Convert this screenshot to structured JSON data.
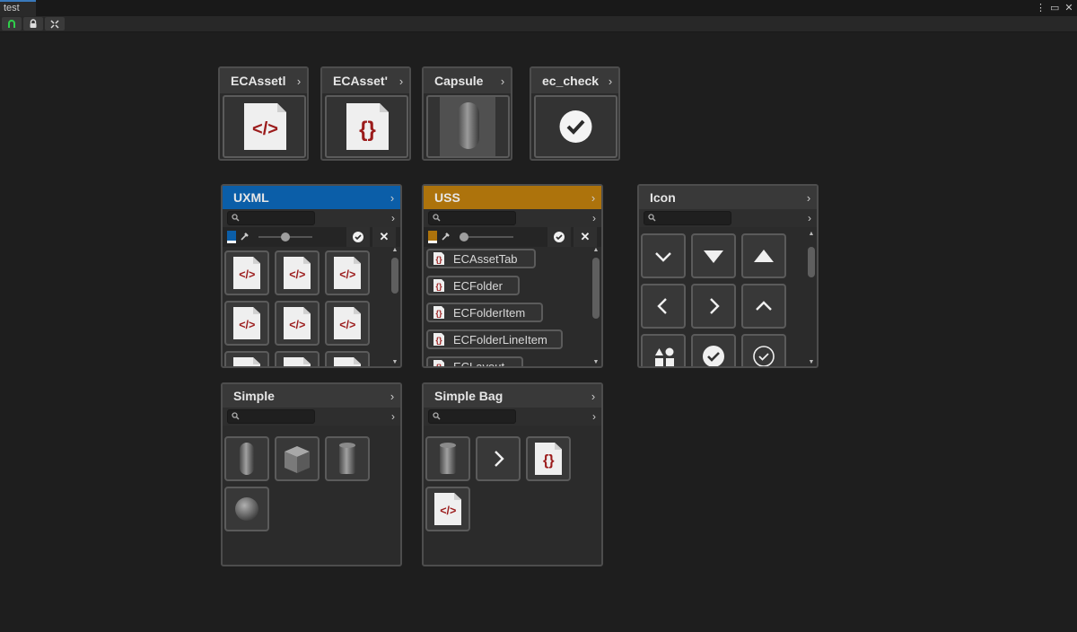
{
  "window": {
    "tab_title": "test",
    "menu_icon": "kebab-menu-icon",
    "maximize_icon": "maximize-icon",
    "close_icon": "close-icon"
  },
  "toolbar": {
    "buttons": [
      {
        "icon": "magnet-icon"
      },
      {
        "icon": "lock-icon"
      },
      {
        "icon": "collapse-icon"
      }
    ]
  },
  "asset_cards": [
    {
      "title": "ECAssetl",
      "preview": "uxml-file-icon"
    },
    {
      "title": "ECAsset'",
      "preview": "uss-file-icon"
    },
    {
      "title": "Capsule",
      "preview": "capsule-mesh"
    },
    {
      "title": "ec_check",
      "preview": "check-circle-icon"
    }
  ],
  "colors": {
    "uxml_header": "#0b5ea8",
    "uss_header": "#ad730c",
    "background": "#1e1e1e",
    "panel": "#2b2b2b",
    "file_red": "#9b1b1b"
  },
  "uxml_panel": {
    "title": "UXML",
    "grid_icons": [
      "uxml-file-icon",
      "uxml-file-icon",
      "uxml-file-icon",
      "uxml-file-icon",
      "uxml-file-icon",
      "uxml-file-icon",
      "uxml-file-icon",
      "uxml-file-icon",
      "uxml-file-icon"
    ],
    "slider_level": 0.5
  },
  "uss_panel": {
    "title": "USS",
    "items": [
      "ECAssetTab",
      "ECFolder",
      "ECFolderItem",
      "ECFolderLineItem",
      "ECLayout"
    ],
    "slider_level": 0.0
  },
  "icon_panel": {
    "title": "Icon",
    "icons": [
      "chevron-down-icon",
      "triangle-down-icon",
      "triangle-up-icon",
      "chevron-left-icon",
      "chevron-right-icon",
      "chevron-up-icon",
      "shapes-icon",
      "check-circle-filled-icon",
      "check-circle-outline-icon"
    ]
  },
  "simple_panel": {
    "title": "Simple",
    "items": [
      "capsule-mesh",
      "cube-mesh",
      "cylinder-mesh",
      "sphere-mesh"
    ]
  },
  "simple_bag_panel": {
    "title": "Simple Bag",
    "items": [
      "cylinder-mesh",
      "chevron-right-icon",
      "uss-file-icon",
      "uxml-file-icon"
    ]
  }
}
